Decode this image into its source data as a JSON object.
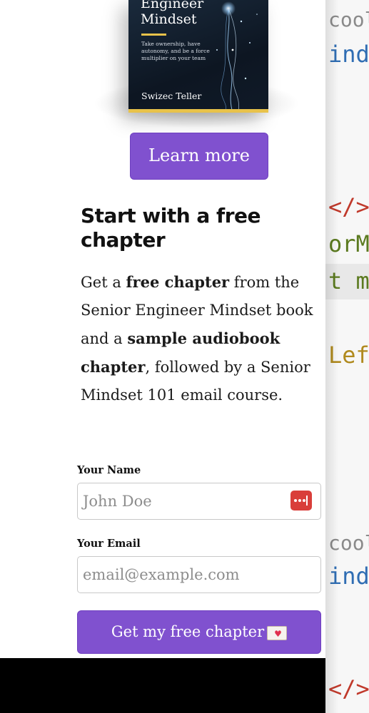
{
  "book": {
    "title_line1": "Engineer",
    "title_line2": "Mindset",
    "tagline": "Take ownership, have autonomy, and be a force multiplier on your team",
    "author": "Swizec Teller"
  },
  "learn_more_label": "Learn more",
  "signup": {
    "heading": "Start with a free chapter",
    "intro_1": "Get a ",
    "intro_bold_1": "free chapter",
    "intro_2": " from the Senior Engineer Mindset book and a ",
    "intro_bold_2": "sample audiobook chapter",
    "intro_3": ", followed by a Senior Mindset 101 email course.",
    "name_label": "Your Name",
    "name_placeholder": "John Doe",
    "email_label": "Your Email",
    "email_placeholder": "email@example.com",
    "submit_label": "Get my free chapter"
  },
  "background_code": {
    "line1": "cool!",
    "line2": "ind",
    "line3": "</>",
    "line4": "orM",
    "line5": "t m",
    "line6": "Lef",
    "line7": "cool!",
    "line8": "ind",
    "line9": "</>"
  },
  "colors": {
    "accent": "#8051cf",
    "password_manager": "#d93e3a",
    "code_red": "#c0392b",
    "code_blue": "#2f6db3",
    "code_green": "#5b7a1f",
    "code_gold": "#b08a1e"
  },
  "icons": {
    "password_manager": "password-dots-icon",
    "submit": "love-letter-icon"
  }
}
